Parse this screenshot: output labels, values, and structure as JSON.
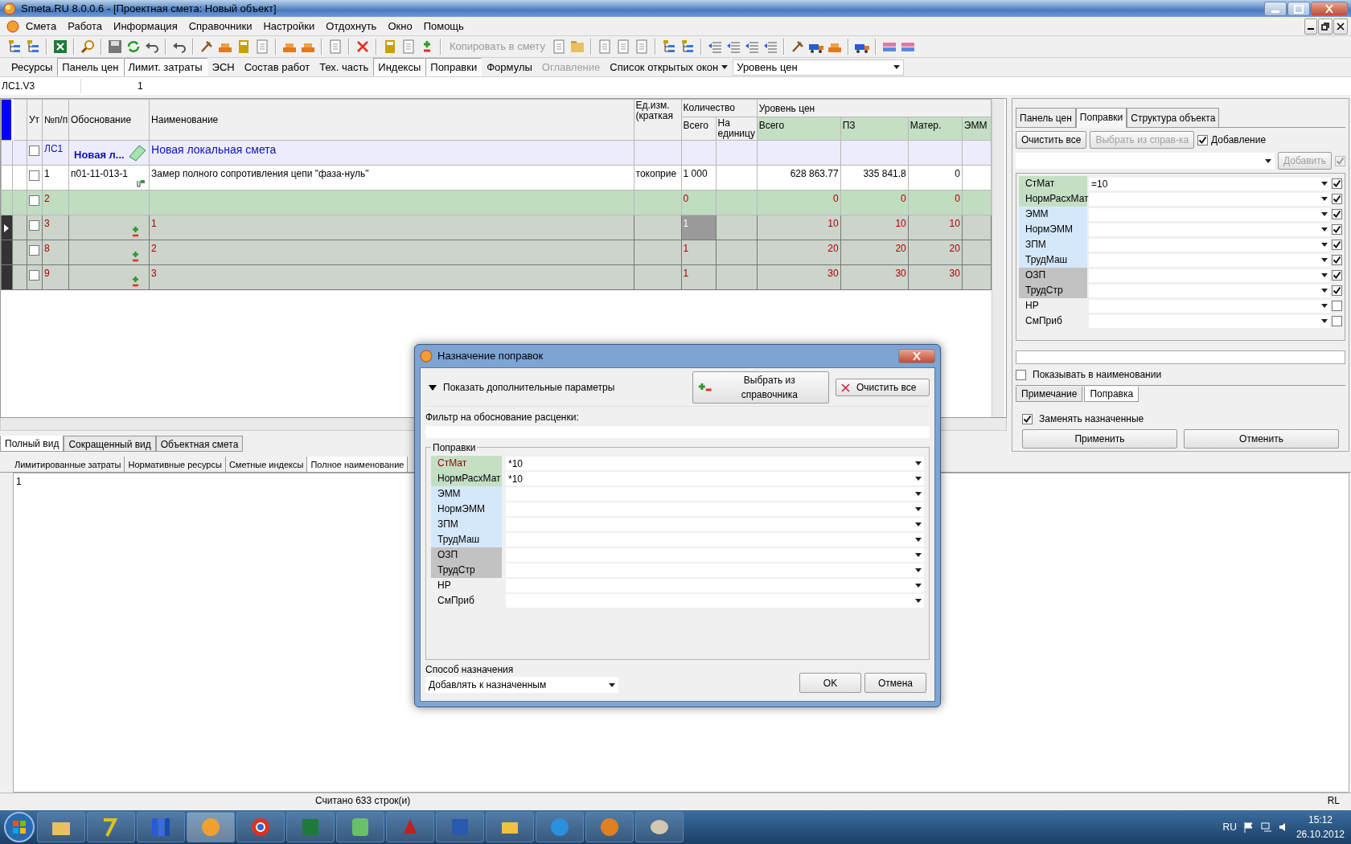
{
  "window": {
    "title": "Smeta.RU  8.0.0.6  - [Проектная смета: Новый объект]"
  },
  "menu": [
    {
      "label": "Смета"
    },
    {
      "label": "Работа"
    },
    {
      "label": "Информация"
    },
    {
      "label": "Справочники"
    },
    {
      "label": "Настройки"
    },
    {
      "label": "Отдохнуть"
    },
    {
      "label": "Окно"
    },
    {
      "label": "Помощь"
    }
  ],
  "toolbar": {
    "copy_button": {
      "label": "Копировать в смету",
      "disabled": true
    }
  },
  "panel_bar": {
    "items": [
      {
        "label": "Ресурсы",
        "pressed": false,
        "disabled": false
      },
      {
        "label": "Панель цен",
        "pressed": true,
        "disabled": false
      },
      {
        "label": "Лимит. затраты",
        "pressed": true,
        "disabled": false
      },
      {
        "label": "ЭСН",
        "pressed": false,
        "disabled": false
      },
      {
        "label": "Состав работ",
        "pressed": false,
        "disabled": false
      },
      {
        "label": "Тех. часть",
        "pressed": false,
        "disabled": false
      },
      {
        "label": "Индексы",
        "pressed": true,
        "disabled": false
      },
      {
        "label": "Поправки",
        "pressed": true,
        "disabled": false
      },
      {
        "label": "Формулы",
        "pressed": false,
        "disabled": false
      },
      {
        "label": "Оглавление",
        "pressed": false,
        "disabled": true
      }
    ],
    "windows_menu": "Список открытых окон",
    "price_level": "Уровень цен"
  },
  "formula_bar": {
    "cell": "ЛС1.V3",
    "value": "1"
  },
  "table": {
    "headers": {
      "ut": "Ут",
      "num": "№п/п",
      "basis": "Обоснование",
      "name": "Наименование",
      "unit": "Ед.изм. (краткая",
      "qty": "Количество",
      "qty_total": "Всего",
      "qty_per": "На единицу",
      "price_level": "Уровень цен",
      "pl_total": "Всего",
      "pz": "ПЗ",
      "mater": "Матер.",
      "emm": "ЭММ"
    },
    "rows": [
      {
        "kind": "section",
        "selected": false,
        "checked": false,
        "num": "ЛС1",
        "basis": "Новая л...",
        "name": "Новая локальная смета"
      },
      {
        "kind": "item",
        "selected": false,
        "checked": false,
        "num": "1",
        "basis": "п01-11-013-1",
        "name": "Замер полного сопротивления цепи \"фаза-нуль\"",
        "unit": "токоприе",
        "qty": "1 000",
        "total": "628 863.77",
        "pz": "335 841.8",
        "mater": "0"
      },
      {
        "kind": "group",
        "selected": false,
        "checked": false,
        "num": "2",
        "qty": "0",
        "total": "0",
        "pz": "0",
        "mater": "0"
      },
      {
        "kind": "sub",
        "selected": true,
        "checked": false,
        "num": "3",
        "name": "1",
        "qty": "1",
        "total": "10",
        "pz": "10",
        "mater": "10"
      },
      {
        "kind": "sub",
        "selected": false,
        "checked": false,
        "num": "8",
        "name": "2",
        "qty": "1",
        "total": "20",
        "pz": "20",
        "mater": "20"
      },
      {
        "kind": "sub",
        "selected": false,
        "checked": false,
        "num": "9",
        "name": "3",
        "qty": "1",
        "total": "30",
        "pz": "30",
        "mater": "30"
      }
    ]
  },
  "view_tabs": [
    {
      "label": "Полный вид",
      "selected": true
    },
    {
      "label": "Сокращенный вид",
      "selected": false
    },
    {
      "label": "Объектная смета",
      "selected": false
    }
  ],
  "detail_tabs": [
    {
      "label": "Лимитированные затраты",
      "selected": false
    },
    {
      "label": "Нормативные ресурсы",
      "selected": false
    },
    {
      "label": "Сметные индексы",
      "selected": false
    },
    {
      "label": "Полное наименование",
      "selected": true
    }
  ],
  "detail_text": "1",
  "side_panel": {
    "tabs": [
      {
        "label": "Панель цен",
        "selected": false
      },
      {
        "label": "Поправки",
        "selected": true
      },
      {
        "label": "Структура объекта",
        "selected": false
      }
    ],
    "clear_button": "Очистить все",
    "pick_button": {
      "label": "Выбрать из справ-ка",
      "disabled": true
    },
    "append": {
      "label": "Добавление",
      "checked": true
    },
    "add_button": {
      "label": "Добавить",
      "disabled": true
    },
    "add_check": {
      "checked": true,
      "disabled": true
    },
    "corrections": [
      {
        "label": "СтМат",
        "value": "=10",
        "kind": "materials",
        "checked": true
      },
      {
        "label": "НормРасхМат",
        "kind": "materials",
        "checked": true
      },
      {
        "label": "ЭММ",
        "kind": "machines",
        "checked": true
      },
      {
        "label": "НормЭММ",
        "kind": "machines",
        "checked": true
      },
      {
        "label": "ЗПМ",
        "kind": "machines",
        "checked": true
      },
      {
        "label": "ТрудМаш",
        "kind": "machines",
        "checked": true
      },
      {
        "label": "ОЗП",
        "kind": "labor",
        "checked": true
      },
      {
        "label": "ТрудСтр",
        "kind": "labor",
        "checked": true
      },
      {
        "label": "НР",
        "kind": "plain",
        "checked": false
      },
      {
        "label": "СмПриб",
        "kind": "plain",
        "checked": false
      }
    ],
    "show_in_name": {
      "label": "Показывать в наименовании",
      "checked": false
    },
    "note_tabs": [
      {
        "label": "Примечание",
        "selected": false
      },
      {
        "label": "Поправка",
        "selected": true
      }
    ],
    "replace": {
      "label": "Заменять назначенные",
      "checked": true
    },
    "apply_button": "Применить",
    "cancel_button": "Отменить"
  },
  "dialog": {
    "title": "Назначение поправок",
    "expander": "Показать дополнительные параметры",
    "pick_button": "Выбрать из справочника",
    "clear_button": "Очистить все",
    "filter_label": "Фильтр на обоснование расценки:",
    "group_label": "Поправки",
    "corrections": [
      {
        "label": "СтМат",
        "value": "*10",
        "kind": "materials",
        "current": true
      },
      {
        "label": "НормРасхМат",
        "value": "*10",
        "kind": "materials",
        "current": false
      },
      {
        "label": "ЭММ",
        "kind": "machines",
        "current": false
      },
      {
        "label": "НормЭММ",
        "kind": "machines",
        "current": false
      },
      {
        "label": "ЗПМ",
        "kind": "machines",
        "current": false
      },
      {
        "label": "ТрудМаш",
        "kind": "machines",
        "current": false
      },
      {
        "label": "ОЗП",
        "kind": "labor",
        "current": false
      },
      {
        "label": "ТрудСтр",
        "kind": "labor",
        "current": false
      },
      {
        "label": "НР",
        "kind": "plain",
        "current": false
      },
      {
        "label": "СмПриб",
        "kind": "plain",
        "current": false
      }
    ],
    "method_label": "Способ назначения",
    "method_value": "Добавлять к назначенным",
    "ok_button": "OK",
    "cancel_button": "Отмена"
  },
  "status_bar": {
    "message": "Считано 633 строк(и)",
    "mode": "RL"
  },
  "taskbar": {
    "language": "RU",
    "time": "15:12",
    "date": "26.10.2012"
  }
}
